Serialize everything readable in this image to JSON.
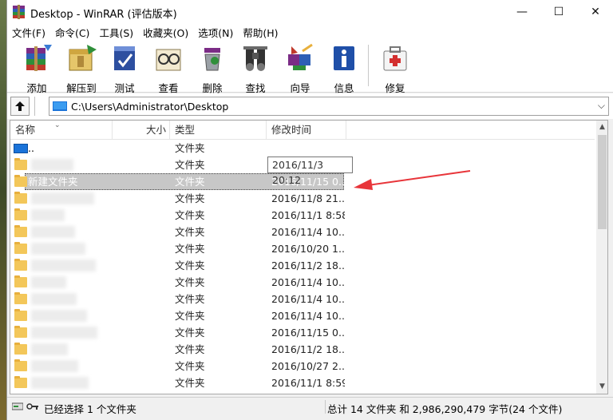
{
  "window": {
    "title": "Desktop - WinRAR (评估版本)",
    "controls": {
      "minimize": "—",
      "maximize": "☐",
      "close": "✕"
    }
  },
  "menu": [
    "文件(F)",
    "命令(C)",
    "工具(S)",
    "收藏夹(O)",
    "选项(N)",
    "帮助(H)"
  ],
  "toolbar": [
    {
      "label": "添加",
      "icon": "add-archive-icon"
    },
    {
      "label": "解压到",
      "icon": "extract-to-icon"
    },
    {
      "label": "测试",
      "icon": "test-icon"
    },
    {
      "label": "查看",
      "icon": "view-icon"
    },
    {
      "label": "删除",
      "icon": "delete-icon"
    },
    {
      "label": "查找",
      "icon": "find-icon"
    },
    {
      "label": "向导",
      "icon": "wizard-icon"
    },
    {
      "label": "信息",
      "icon": "info-icon"
    },
    {
      "label": "修复",
      "icon": "repair-icon"
    }
  ],
  "path": {
    "value": "C:\\Users\\Administrator\\Desktop"
  },
  "columns": {
    "name": "名称",
    "size": "大小",
    "type": "类型",
    "modified": "修改时间"
  },
  "rows": [
    {
      "name": "..",
      "type": "文件夹",
      "modified": "",
      "icon": "parent-dir-icon"
    },
    {
      "name": "",
      "type": "文件夹",
      "modified": "",
      "icon": "folder-icon"
    },
    {
      "name": "新建文件夹",
      "type": "文件夹",
      "modified": "2016/11/15 0...",
      "icon": "folder-icon",
      "selected": true
    },
    {
      "name": "",
      "type": "文件夹",
      "modified": "2016/11/8 21...",
      "icon": "folder-icon"
    },
    {
      "name": "",
      "type": "文件夹",
      "modified": "2016/11/1 8:58",
      "icon": "folder-icon"
    },
    {
      "name": "",
      "type": "文件夹",
      "modified": "2016/11/4 10...",
      "icon": "folder-icon"
    },
    {
      "name": "",
      "type": "文件夹",
      "modified": "2016/10/20 1...",
      "icon": "folder-icon"
    },
    {
      "name": "",
      "type": "文件夹",
      "modified": "2016/11/2 18...",
      "icon": "folder-icon"
    },
    {
      "name": "",
      "type": "文件夹",
      "modified": "2016/11/4 10...",
      "icon": "folder-icon"
    },
    {
      "name": "",
      "type": "文件夹",
      "modified": "2016/11/4 10...",
      "icon": "folder-icon"
    },
    {
      "name": "",
      "type": "文件夹",
      "modified": "2016/11/4 10...",
      "icon": "folder-icon"
    },
    {
      "name": "",
      "type": "文件夹",
      "modified": "2016/11/15 0...",
      "icon": "folder-icon"
    },
    {
      "name": "",
      "type": "文件夹",
      "modified": "2016/11/2 18...",
      "icon": "folder-icon"
    },
    {
      "name": "",
      "type": "文件夹",
      "modified": "2016/10/27 2...",
      "icon": "folder-icon"
    },
    {
      "name": "",
      "type": "文件夹",
      "modified": "2016/11/1 8:59",
      "icon": "folder-icon"
    }
  ],
  "tooltip": "2016/11/3 20:12",
  "status": {
    "left": "已经选择 1 个文件夹",
    "right": "总计 14 文件夹 和 2,986,290,479 字节(24 个文件)"
  },
  "colors": {
    "selection": "#c7c7c7",
    "annotation_arrow": "#e8353a",
    "folder": "#f3c75a"
  }
}
